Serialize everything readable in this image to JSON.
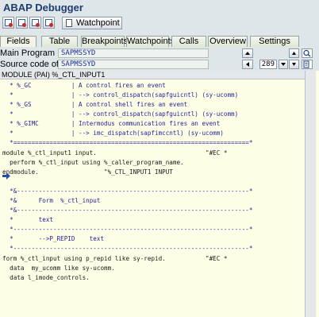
{
  "window": {
    "title": "ABAP Debugger"
  },
  "toolbar": {
    "watchpoint_label": "Watchpoint"
  },
  "tabs": [
    {
      "label": "Fields"
    },
    {
      "label": "Table"
    },
    {
      "label": "Breakpoints"
    },
    {
      "label": "Watchpoints"
    },
    {
      "label": "Calls"
    },
    {
      "label": "Overview"
    },
    {
      "label": "Settings"
    }
  ],
  "info": {
    "main_program_label": "Main Program",
    "main_program_value": "SAPMSSYD",
    "source_label": "Source code of",
    "source_value": "SAPMSSYD",
    "line_number": "289"
  },
  "editor": {
    "header": "MODULE (PAI) %_CTL_INPUT1",
    "lines": [
      "  * %_GC           | A control fires an event",
      "  *                | --> control_dispatch(sapfguicntl) (sy-ucomm)",
      "  * %_GS           | A control shell fires an event",
      "  *                | --> control_dispatch(sapfguicntl) (sy-ucomm)",
      "  * %_GIMC         | Intermodus communication fires an event",
      "  *                | --> imc_dispatch(sapfimccntl) (sy-ucomm)",
      "  *=================================================================*",
      "module %_ctl_input1 input.                              \"#EC *",
      "  perform %_ctl_input using %_caller_program_name.",
      "endmodule.                  \"%_CTL_INPUT1 INPUT",
      "",
      "  *&----------------------------------------------------------------*",
      "  *&      Form  %_ctl_input",
      "  *&----------------------------------------------------------------*",
      "  *       text",
      "  *-----------------------------------------------------------------*",
      "  *       -->P_REPID    text",
      "  *-----------------------------------------------------------------*",
      "form %_ctl_input using p_repid like sy-repid.           \"#EC *",
      "  data  my_ucomm like sy-ucomm.",
      "  data l_imode_controls."
    ]
  }
}
